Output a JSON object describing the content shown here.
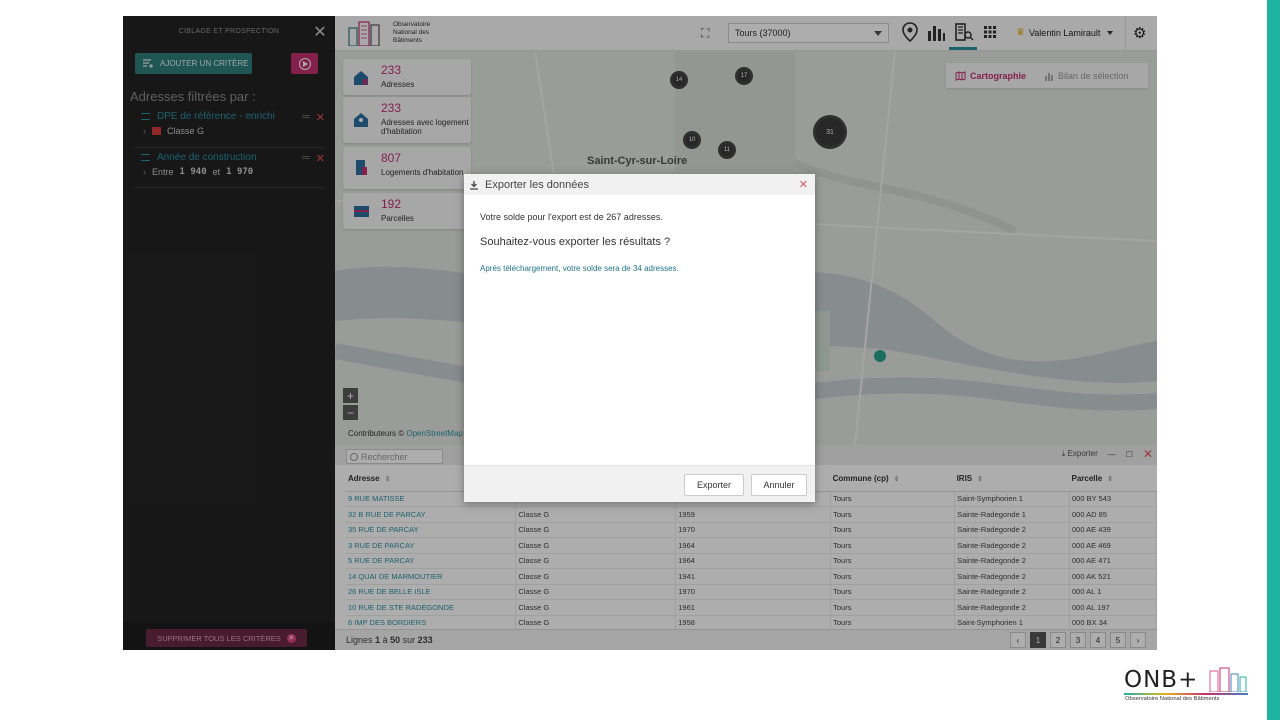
{
  "sidebar": {
    "header_title": "CIBLAGE ET PROSPECTION",
    "add_criterion_label": "AJOUTER UN CRITÈRE",
    "filter_heading": "Adresses filtrées par :",
    "criteria": [
      {
        "name": "DPE de référence - enrichi",
        "value_label": "Classe G",
        "swatch_color": "#d63a3a"
      },
      {
        "name": "Année de construction",
        "prefix": "Entre",
        "from": "1 940",
        "conj": "et",
        "to": "1 970"
      }
    ],
    "delete_all_label": "SUPPRIMER TOUS LES CRITÈRES"
  },
  "topbar": {
    "logo_text": [
      "Observatoire",
      "National des",
      "Bâtiments"
    ],
    "city": "Tours (37000)",
    "user_name": "Valentin Lamirault"
  },
  "map": {
    "stats": [
      {
        "value": "233",
        "label": "Adresses",
        "icon": "house-icon"
      },
      {
        "value": "233",
        "label": "Adresses avec logement d'habitation",
        "icon": "home-person-icon"
      },
      {
        "value": "807",
        "label": "Logements d'habitation",
        "icon": "apartment-icon"
      },
      {
        "value": "192",
        "label": "Parcelles",
        "icon": "parcel-icon"
      }
    ],
    "tabs": [
      {
        "label": "Cartographie",
        "active": true
      },
      {
        "label": "Bilan de sélection",
        "active": false
      }
    ],
    "place_label": "Saint-Cyr-sur-Loire",
    "clusters": [
      "14",
      "17",
      "31",
      "10",
      "11"
    ],
    "attribution_prefix": "Contributeurs ©",
    "attribution_link": "OpenStreetMap"
  },
  "table": {
    "search_placeholder": "Rechercher",
    "export_label": "Exporter",
    "columns": [
      "Adresse",
      "",
      "",
      "Commune (cp)",
      "IRIS",
      "Parcelle"
    ],
    "rows": [
      [
        "9 RUE MATISSE",
        "",
        "",
        "Tours",
        "Saint-Symphorien 1",
        "000 BY 543"
      ],
      [
        "32 B RUE DE PARCAY",
        "Classe G",
        "1959",
        "Tours",
        "Sainte-Radegonde 1",
        "000 AD 85"
      ],
      [
        "35 RUE DE PARCAY",
        "Classe G",
        "1970",
        "Tours",
        "Sainte-Radegonde 2",
        "000 AE 439"
      ],
      [
        "3 RUE DE PARCAY",
        "Classe G",
        "1964",
        "Tours",
        "Sainte-Radegonde 2",
        "000 AE 469"
      ],
      [
        "5 RUE DE PARCAY",
        "Classe G",
        "1964",
        "Tours",
        "Sainte-Radegonde 2",
        "000 AE 471"
      ],
      [
        "14 QUAI DE MARMOUTIER",
        "Classe G",
        "1941",
        "Tours",
        "Sainte-Radegonde 2",
        "000 AK 521"
      ],
      [
        "26 RUE DE BELLE ISLE",
        "Classe G",
        "1970",
        "Tours",
        "Sainte-Radegonde 2",
        "000 AL 1"
      ],
      [
        "10 RUE DE STE RADEGONDE",
        "Classe G",
        "1961",
        "Tours",
        "Sainte-Radegonde 2",
        "000 AL 197"
      ],
      [
        "6 IMP DES BORDIERS",
        "Classe G",
        "1958",
        "Tours",
        "Saint-Symphorien 1",
        "000 BX 34"
      ]
    ],
    "pager": {
      "prefix": "Lignes",
      "from": "1",
      "to_word": "à",
      "to": "50",
      "of_word": "sur",
      "total": "233"
    },
    "pages": [
      "1",
      "2",
      "3",
      "4",
      "5"
    ]
  },
  "modal": {
    "title": "Exporter les données",
    "line1": "Votre solde pour l'export est de 267 adresses.",
    "line2": "Souhaitez-vous exporter les résultats ?",
    "line3": "Après téléchargement, votre solde sera de 34 adresses.",
    "export_button": "Exporter",
    "cancel_button": "Annuler"
  },
  "footer_logo": {
    "brand": "ONB+",
    "subtitle": "Observatoire National des Bâtiments"
  },
  "colors": {
    "accent_teal": "#2f7f7c",
    "accent_pink": "#c2306f",
    "link_blue": "#2d8fa6",
    "close_red": "#e2555b",
    "brand_strip": "#1fb3a2"
  }
}
